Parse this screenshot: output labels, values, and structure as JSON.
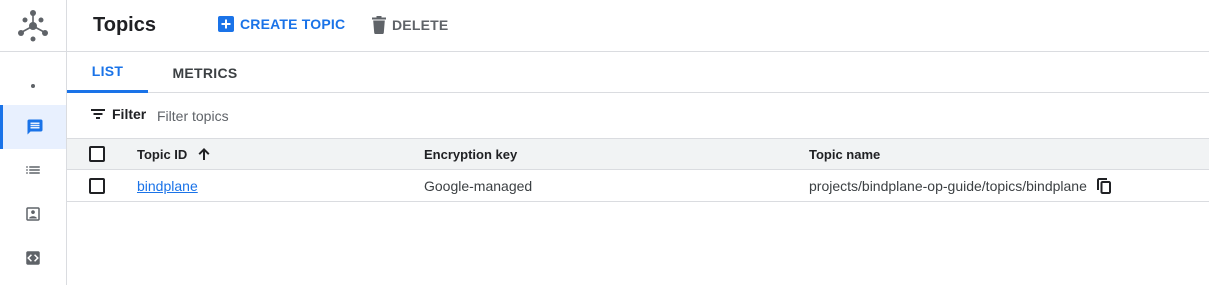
{
  "header": {
    "title": "Topics",
    "create_label": "CREATE TOPIC",
    "delete_label": "DELETE"
  },
  "tabs": [
    {
      "label": "LIST",
      "active": true
    },
    {
      "label": "METRICS",
      "active": false
    }
  ],
  "filter": {
    "label": "Filter",
    "placeholder": "Filter topics"
  },
  "table": {
    "columns": [
      "Topic ID",
      "Encryption key",
      "Topic name"
    ],
    "sort": "ascending",
    "rows": [
      {
        "topic_id": "bindplane",
        "encryption_key": "Google-managed",
        "topic_name": "projects/bindplane-op-guide/topics/bindplane"
      }
    ]
  },
  "rail": {
    "items": [
      "dot",
      "topics-icon",
      "list-icon",
      "snapshot-icon",
      "code-icon"
    ],
    "active": "topics-icon"
  },
  "colors": {
    "accent": "#1a73e8",
    "text": "#202124",
    "muted": "#5f6368",
    "border": "#dadce0",
    "header_bg": "#f1f3f4",
    "active_bg": "#e8f0fe"
  }
}
